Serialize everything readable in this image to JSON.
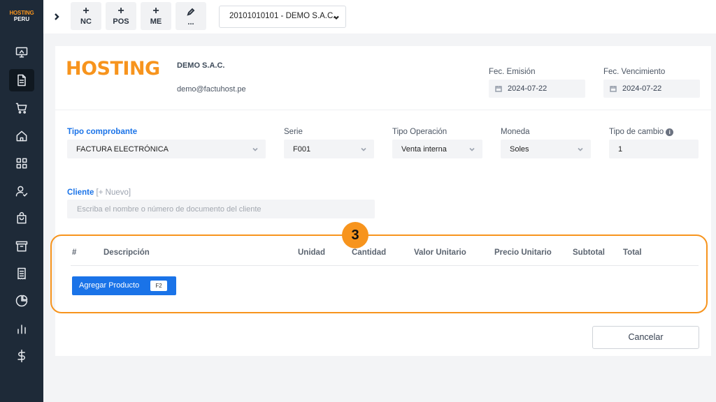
{
  "sidebar": {
    "logo_line1": "HOSTING",
    "logo_line2": "PERU",
    "items": [
      {
        "icon": "monitor-icon"
      },
      {
        "icon": "document-icon",
        "active": true
      },
      {
        "icon": "cart-icon"
      },
      {
        "icon": "home-icon"
      },
      {
        "icon": "grid-icon"
      },
      {
        "icon": "user-check-icon"
      },
      {
        "icon": "bag-icon"
      },
      {
        "icon": "archive-icon"
      },
      {
        "icon": "receipt-icon"
      },
      {
        "icon": "pie-chart-icon"
      },
      {
        "icon": "bar-chart-icon"
      },
      {
        "icon": "dollar-icon"
      }
    ]
  },
  "topbar": {
    "quick_actions": [
      {
        "symbol": "+",
        "label": "NC"
      },
      {
        "symbol": "+",
        "label": "POS"
      },
      {
        "symbol": "+",
        "label": "ME"
      },
      {
        "symbol": "pencil",
        "label": "..."
      }
    ],
    "company_select": "20101010101 - DEMO S.A.C."
  },
  "header": {
    "brand": "HOSTING",
    "company_name": "DEMO S.A.C.",
    "email": "demo@factuhost.pe",
    "fec_emision_label": "Fec. Emisión",
    "fec_emision": "2024-07-22",
    "fec_vencimiento_label": "Fec. Vencimiento",
    "fec_vencimiento": "2024-07-22"
  },
  "form": {
    "tipo_comprobante_label": "Tipo comprobante",
    "tipo_comprobante": "FACTURA ELECTRÓNICA",
    "serie_label": "Serie",
    "serie": "F001",
    "tipo_operacion_label": "Tipo Operación",
    "tipo_operacion": "Venta interna",
    "moneda_label": "Moneda",
    "moneda": "Soles",
    "tipo_cambio_label": "Tipo de cambio",
    "tipo_cambio": "1",
    "cliente_label": "Cliente",
    "cliente_nuevo": "[+ Nuevo]",
    "cliente_placeholder": "Escriba el nombre o número de documento del cliente"
  },
  "table": {
    "headers": [
      "#",
      "Descripción",
      "Unidad",
      "Cantidad",
      "Valor Unitario",
      "Precio Unitario",
      "Subtotal",
      "Total"
    ]
  },
  "actions": {
    "add_product": "Agregar Producto",
    "add_product_key": "F2",
    "cancel": "Cancelar"
  },
  "step_badge": "3",
  "colors": {
    "accent": "#f7941d",
    "primary": "#1a73e8",
    "sidebar_bg": "#1e2a38"
  }
}
